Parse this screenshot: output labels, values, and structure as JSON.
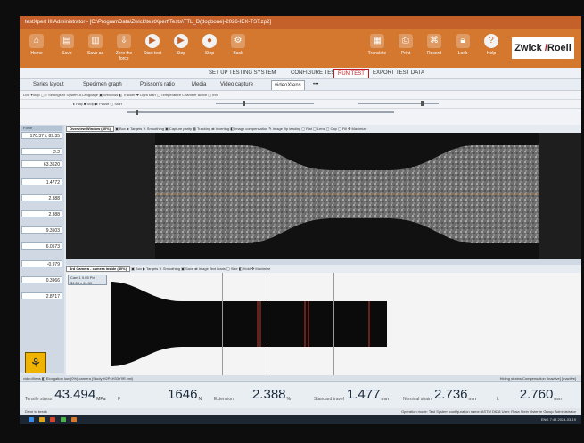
{
  "window": {
    "title": "testXpert III Administrator - [C:\\ProgramData\\Zwick\\testXpert\\Tests\\TTL_D(dogbone)-2026-IEX-TST.zp2]"
  },
  "ribbon": {
    "buttons": [
      {
        "label": "Home",
        "icon": "home-icon"
      },
      {
        "label": "Save",
        "icon": "save-icon"
      },
      {
        "label": "Save as",
        "icon": "save-as-icon"
      },
      {
        "label": "Zero the force",
        "icon": "zero-icon"
      },
      {
        "label": "Start test",
        "icon": "start-icon"
      },
      {
        "label": "Stop",
        "icon": "stop-icon"
      },
      {
        "label": "Stop",
        "icon": "stop-circle-icon"
      },
      {
        "label": "Back",
        "icon": "back-icon"
      }
    ],
    "right_buttons": [
      {
        "label": "Translate",
        "icon": "translate-icon"
      },
      {
        "label": "Print",
        "icon": "print-icon"
      },
      {
        "label": "Record",
        "icon": "record-icon"
      },
      {
        "label": "Lock",
        "icon": "lock-icon"
      },
      {
        "label": "Help",
        "icon": "help-icon"
      }
    ],
    "brand_left": "Zwick",
    "brand_right": "Roell"
  },
  "test_tabs": [
    {
      "label": "SET UP TESTING SYSTEM",
      "active": false
    },
    {
      "label": "CONFIGURE TEST",
      "active": false
    },
    {
      "label": "RUN TEST",
      "active": true
    },
    {
      "label": "EXPORT TEST DATA",
      "active": false
    }
  ],
  "sub_tabs": [
    {
      "label": "Series layout",
      "active": false
    },
    {
      "label": "Specimen graph",
      "active": false
    },
    {
      "label": "Poisson's ratio",
      "active": false
    },
    {
      "label": "Media",
      "active": false
    },
    {
      "label": "Video capture",
      "active": false
    },
    {
      "label": "videoXtens",
      "active": true
    },
    {
      "label": "•••",
      "active": false
    }
  ],
  "toolbar1_text": "Live  ▾Stop  ▢  ≡ Settings  ⚙ System  A Language  ▣ Windows  ◧ Tracker  ✚ Light start          ▢ Temperature Chamber active  ▢ Info",
  "toolbar2_text": "▸ Play  ■ Stop  ▶ Pause  ▢ Start",
  "left_panel": {
    "head1": "Force",
    "values": [
      "170.37 ± 89.35",
      "2.2",
      "63.3620",
      "1.4772",
      "2.388",
      "2.388",
      "9.3503",
      "6.0573",
      "-0.979",
      "0.3966",
      "2.8717"
    ]
  },
  "video1": {
    "label": "Overview Window (40%)",
    "toolbar_text": "▣ Box  ▶ Targets  ✎ Smoothing  ▣ Capture parity  ▦ Tracking  ⇄ Inverting  ◧ Image compensation  ✎ Image flip leading  ▢ Flat  ▢ Lens  ▢ Cap  ▢ Fill  ✥ Maximize"
  },
  "video2": {
    "label": "3rd Camera - camera inside (40%)",
    "toolbar_text": "▣ Box  ▶ Targets  ✎ Smoothing  ▣ Save  ⇄ Image Text loads  ▢ Size  ◧ Hold  ✥ Maximize",
    "info_line1": "Cam 1   0.65 Pix",
    "info_line2": "$1.55 x 61.30"
  },
  "status1_text": "videoXtens  ◧  Elongation low (0%) camera (Study:H2P4H33Y9R.xml)",
  "status1_right": "Hiding strains Compensation [Inactive]  [Inactive]",
  "results": [
    {
      "label": "Tensile stress",
      "value": "43.494",
      "unit": "MPa"
    },
    {
      "label": "F",
      "value": "1646",
      "unit": "N"
    },
    {
      "label": "Extension",
      "value": "2.388",
      "unit": "%"
    },
    {
      "label": "Standard travel",
      "value": "1.477",
      "unit": "mm"
    },
    {
      "label": "Nominal strain",
      "value": "2.736",
      "unit": "mm"
    },
    {
      "label": "L",
      "value": "2.760",
      "unit": "mm"
    }
  ],
  "status2": {
    "left": "Drive to break",
    "right": "Operation mode: Test    System configuration name: ASTM D638    User: Rosa Stein Osterrie    Group: Administrator"
  },
  "tray": {
    "time": "7:48",
    "date": "2024-03-19",
    "lang": "ENG"
  }
}
